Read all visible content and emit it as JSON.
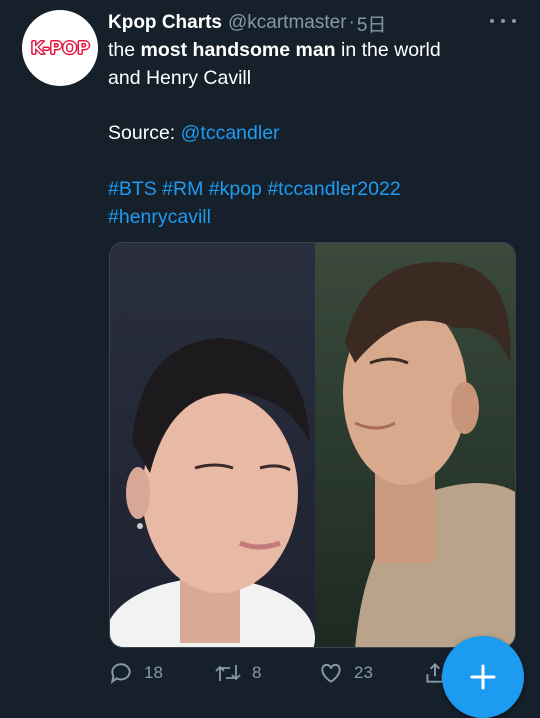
{
  "tweet": {
    "avatar_text": "K-POP",
    "display_name": "Kpop Charts",
    "handle": "@kcartmaster",
    "separator": "·",
    "time": "5日",
    "line1_a": "the ",
    "line1_bold": "most handsome man",
    "line1_b": " in the world",
    "line2": "and Henry Cavill",
    "source_label": "Source: ",
    "source_link": "@tccandler",
    "hashtags_line1": "#BTS #RM #kpop #tccandler2022",
    "hashtags_line2": "#henrycavill"
  },
  "actions": {
    "reply_count": "18",
    "retweet_count": "8",
    "like_count": "23"
  },
  "colors": {
    "background": "#15202b",
    "link": "#1d9bf0",
    "muted": "#8899a6",
    "avatar_brand": "#e3173e"
  },
  "icons": [
    "more-icon",
    "reply-icon",
    "retweet-icon",
    "like-icon",
    "share-icon",
    "compose-plus-icon"
  ]
}
